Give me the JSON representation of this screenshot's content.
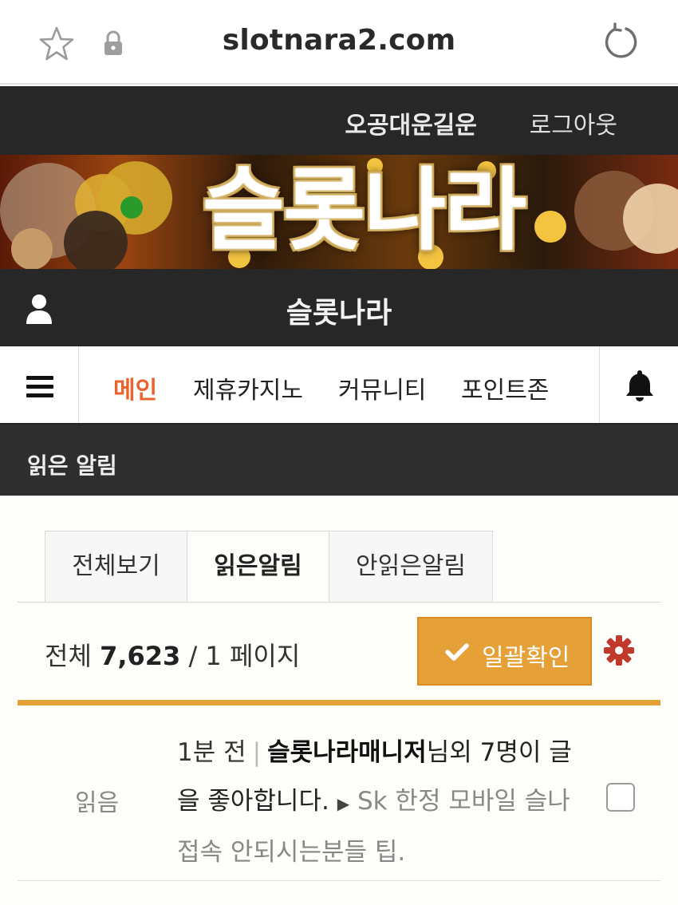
{
  "browser": {
    "url": "slotnara2.com",
    "icons": [
      "star-icon",
      "lock-icon",
      "reload-icon"
    ]
  },
  "topbar": {
    "username": "오공대운길운",
    "logout_label": "로그아웃"
  },
  "banner": {
    "title": "슬롯나라"
  },
  "site_header": {
    "site_name": "슬롯나라",
    "icons": [
      "person-icon"
    ]
  },
  "nav": {
    "items": [
      {
        "label": "메인",
        "active": true
      },
      {
        "label": "제휴카지노",
        "active": false
      },
      {
        "label": "커뮤니티",
        "active": false
      },
      {
        "label": "포인트존",
        "active": false
      }
    ],
    "icons": [
      "hamburger-icon",
      "bell-icon"
    ]
  },
  "section": {
    "title": "읽은 알림"
  },
  "tabs": [
    {
      "label": "전체보기",
      "active": false
    },
    {
      "label": "읽은알림",
      "active": true
    },
    {
      "label": "안읽은알림",
      "active": false
    }
  ],
  "summary": {
    "prefix": "전체",
    "total": "7,623",
    "separator": "/",
    "page": "1 페이지"
  },
  "actions": {
    "confirm_all_label": "일괄확인",
    "icons": [
      "check-icon",
      "gear-icon"
    ]
  },
  "colors": {
    "accent": "#e5a038",
    "nav_active": "#e8642c",
    "dark": "#272727"
  },
  "notifications": [
    {
      "state": "읽음",
      "time": "1분 전",
      "sender": "슬롯나라매니저",
      "text": "님외 7명이 글을 좋아합니다.",
      "post_title": "Sk 한정 모바일 슬나 접속 안되시는분들 팁.",
      "checked": false
    }
  ]
}
